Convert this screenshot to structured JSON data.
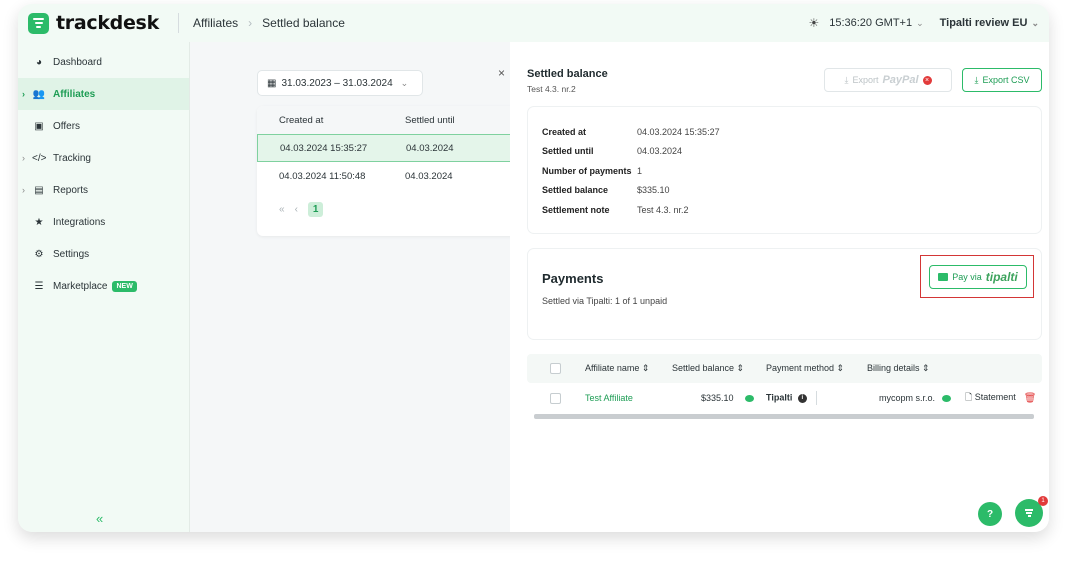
{
  "header": {
    "logo_text": "trackdesk",
    "breadcrumb": [
      "Affiliates",
      "Settled balance"
    ],
    "time": "15:36:20 GMT+1",
    "org": "Tipalti review EU"
  },
  "sidebar": {
    "items": [
      {
        "label": "Dashboard",
        "icon": "pie-chart-icon"
      },
      {
        "label": "Affiliates",
        "icon": "users-icon",
        "active": true
      },
      {
        "label": "Offers",
        "icon": "offers-icon"
      },
      {
        "label": "Tracking",
        "icon": "code-icon"
      },
      {
        "label": "Reports",
        "icon": "reports-icon"
      },
      {
        "label": "Integrations",
        "icon": "puzzle-icon"
      },
      {
        "label": "Settings",
        "icon": "gear-icon"
      },
      {
        "label": "Marketplace",
        "icon": "marketplace-icon",
        "badge": "NEW"
      }
    ],
    "collapse_label": "«"
  },
  "list": {
    "date_range": "31.03.2023 – 31.03.2024",
    "columns": [
      "Created at",
      "Settled until"
    ],
    "rows": [
      {
        "created": "04.03.2024 15:35:27",
        "settled": "04.03.2024"
      },
      {
        "created": "04.03.2024 11:50:48",
        "settled": "04.03.2024"
      }
    ],
    "pager": {
      "first": "«",
      "prev": "‹",
      "current": "1"
    }
  },
  "panel": {
    "title": "Settled balance",
    "subtitle": "Test 4.3. nr.2",
    "export_paypal_label": "Export",
    "paypal_logo": "PayPal",
    "export_csv_label": "Export CSV",
    "details": [
      {
        "label": "Created at",
        "value": "04.03.2024 15:35:27"
      },
      {
        "label": "Settled until",
        "value": "04.03.2024"
      },
      {
        "label": "Number of payments",
        "value": "1"
      },
      {
        "label": "Settled balance",
        "value": "$335.10"
      },
      {
        "label": "Settlement note",
        "value": "Test 4.3. nr.2"
      }
    ],
    "payments": {
      "title": "Payments",
      "subtitle": "Settled via Tipalti: 1 of 1 unpaid",
      "pay_via_label": "Pay via",
      "tipalti_logo": "tipalti"
    },
    "payments_table": {
      "columns": [
        "Affiliate name ⇕",
        "Settled balance ⇕",
        "Payment method ⇕",
        "Billing details ⇕"
      ],
      "row": {
        "affiliate": "Test Affiliate",
        "balance": "$335.10",
        "method": "Tipalti",
        "billing": "mycopm s.r.o.",
        "statement": "Statement"
      }
    }
  },
  "fab": {
    "help": "?",
    "badge": "1"
  },
  "colors": {
    "brand": "#2cbb69",
    "danger": "#e23b3b"
  }
}
